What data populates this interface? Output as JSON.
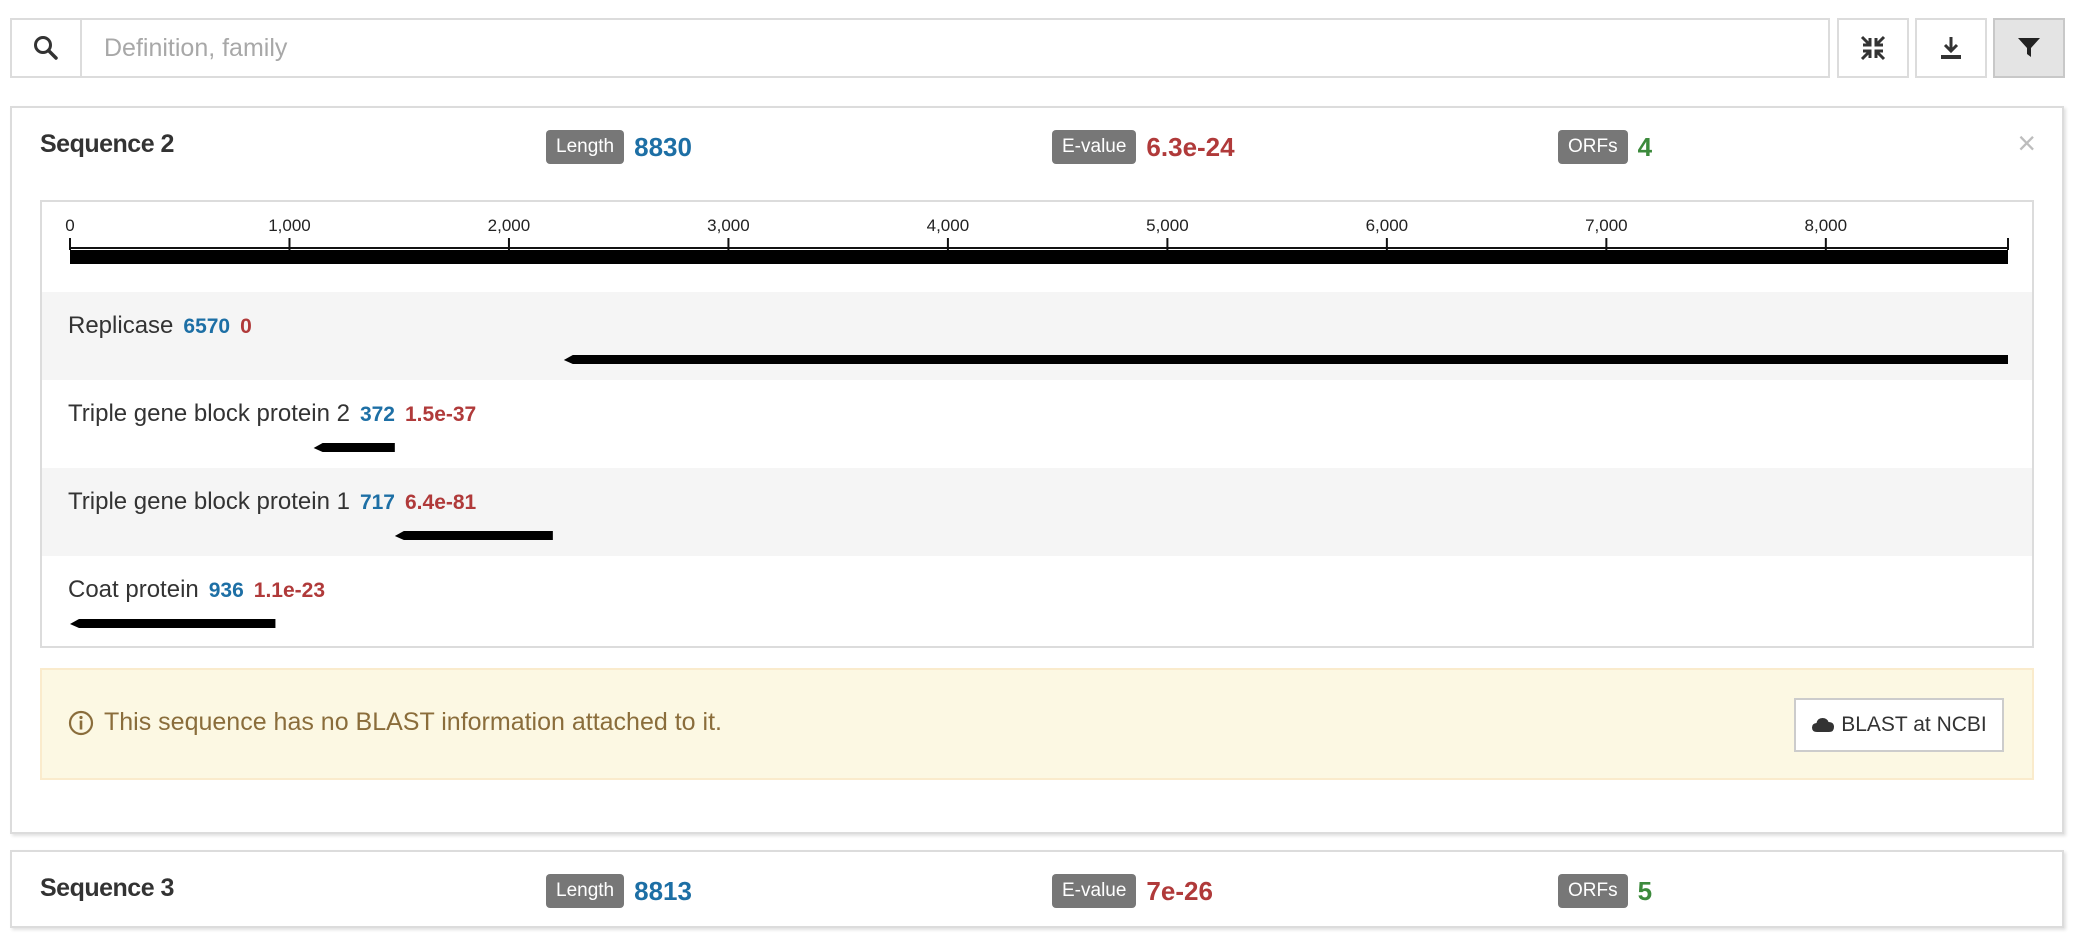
{
  "search": {
    "placeholder": "Definition, family",
    "icon": "search-icon"
  },
  "toolbar": {
    "buttons": [
      {
        "icon": "compress-icon",
        "active": false
      },
      {
        "icon": "download-icon",
        "active": false
      },
      {
        "icon": "filter-icon",
        "active": true
      }
    ]
  },
  "colors": {
    "length": "#1d6fa5",
    "evalue": "#b03a3a",
    "orfs": "#3c8a3c",
    "badge": "#777777",
    "alert_bg": "#fcf8e3",
    "alert_text": "#8a6d3b"
  },
  "sequences": [
    {
      "title": "Sequence 2",
      "length_label": "Length",
      "length": "8830",
      "evalue_label": "E-value",
      "evalue": "6.3e-24",
      "orfs_label": "ORFs",
      "orfs": "4",
      "close": "×",
      "ruler": {
        "max": 8830,
        "ticks": [
          "0",
          "1,000",
          "2,000",
          "3,000",
          "4,000",
          "5,000",
          "6,000",
          "7,000",
          "8,000"
        ]
      },
      "orf_list": [
        {
          "name": "Replicase",
          "length": "6570",
          "evalue": "0",
          "start": 2250,
          "end": 8830,
          "strand": "-"
        },
        {
          "name": "Triple gene block protein 2",
          "length": "372",
          "evalue": "1.5e-37",
          "start": 1110,
          "end": 1480,
          "strand": "-"
        },
        {
          "name": "Triple gene block protein 1",
          "length": "717",
          "evalue": "6.4e-81",
          "start": 1480,
          "end": 2200,
          "strand": "-"
        },
        {
          "name": "Coat protein",
          "length": "936",
          "evalue": "1.1e-23",
          "start": 0,
          "end": 936,
          "strand": "-"
        }
      ],
      "alert": {
        "icon": "info-icon",
        "text": "This sequence has no BLAST information attached to it.",
        "button_icon": "cloud-icon",
        "button_label": "BLAST at NCBI"
      }
    },
    {
      "title": "Sequence 3",
      "length_label": "Length",
      "length": "8813",
      "evalue_label": "E-value",
      "evalue": "7e-26",
      "orfs_label": "ORFs",
      "orfs": "5"
    }
  ]
}
